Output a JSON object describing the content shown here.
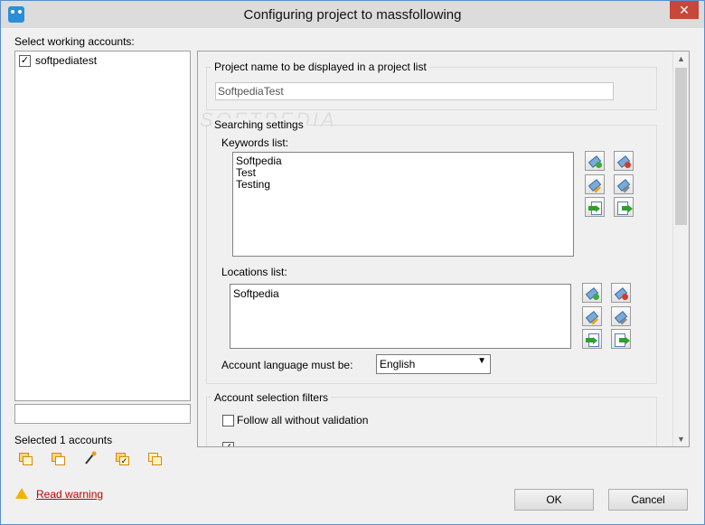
{
  "window": {
    "title": "Configuring project to massfollowing",
    "close_glyph": "✕"
  },
  "left": {
    "label": "Select working accounts:",
    "accounts": [
      {
        "name": "softpediatest",
        "checked": true
      }
    ],
    "filter_value": "",
    "selected_text": "Selected 1 accounts",
    "tool_icons": [
      "select-all-icon",
      "deselect-all-icon",
      "magic-wand-icon",
      "check-selected-icon",
      "check-unselected-icon"
    ]
  },
  "panel": {
    "project_name": {
      "label": "Project name to be displayed in a project list",
      "value": "SoftpediaTest"
    },
    "searching": {
      "title": "Searching settings",
      "keywords_label": "Keywords list:",
      "keywords": [
        "Softpedia",
        "Test",
        "Testing"
      ],
      "locations_label": "Locations list:",
      "locations": [
        "Softpedia"
      ],
      "language_label": "Account language must be:",
      "language_value": "English",
      "chevron": "▼"
    },
    "filters": {
      "title": "Account selection filters",
      "follow_all_label": "Follow all without validation",
      "follow_all_checked": false,
      "partial_checked": true
    },
    "scroll_up": "▲",
    "scroll_down": "▼"
  },
  "footer": {
    "warning_link": "Read warning",
    "ok_label": "OK",
    "cancel_label": "Cancel"
  },
  "watermark": "SOFTPEDIA"
}
